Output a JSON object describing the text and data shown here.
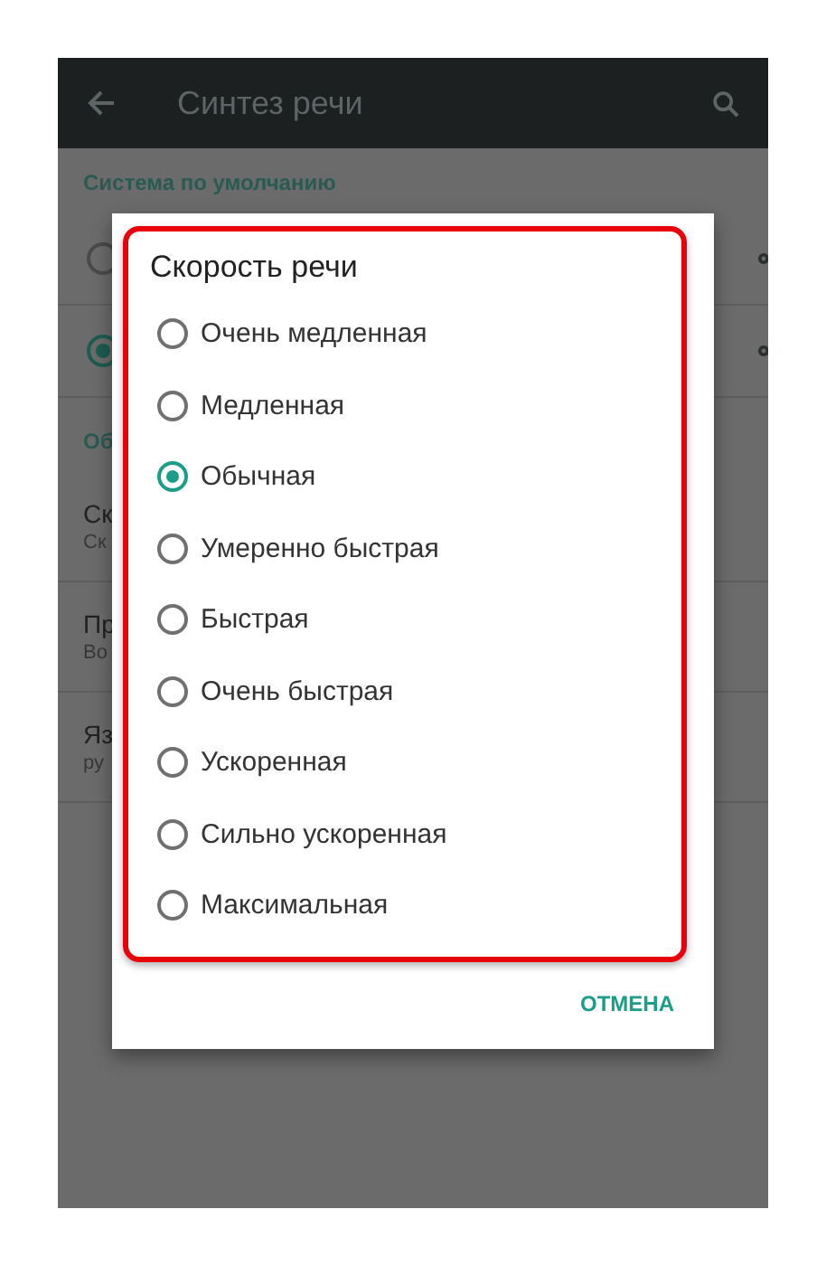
{
  "toolbar": {
    "title": "Синтез речи"
  },
  "background": {
    "section_header": "Система по умолчанию",
    "engines": [
      {
        "selected": false
      },
      {
        "selected": true
      }
    ],
    "section_header_2": "Об",
    "rows": [
      {
        "title": "Ск",
        "subtitle": "Ск"
      },
      {
        "title": "Пр",
        "subtitle": "Во"
      },
      {
        "title": "Яз",
        "subtitle": "ру"
      }
    ]
  },
  "dialog": {
    "title": "Скорость речи",
    "options": [
      {
        "label": "Очень медленная",
        "selected": false
      },
      {
        "label": "Медленная",
        "selected": false
      },
      {
        "label": "Обычная",
        "selected": true
      },
      {
        "label": "Умеренно быстрая",
        "selected": false
      },
      {
        "label": "Быстрая",
        "selected": false
      },
      {
        "label": "Очень быстрая",
        "selected": false
      },
      {
        "label": "Ускоренная",
        "selected": false
      },
      {
        "label": "Сильно ускоренная",
        "selected": false
      },
      {
        "label": "Максимальная",
        "selected": false
      }
    ],
    "cancel": "ОТМЕНА"
  }
}
